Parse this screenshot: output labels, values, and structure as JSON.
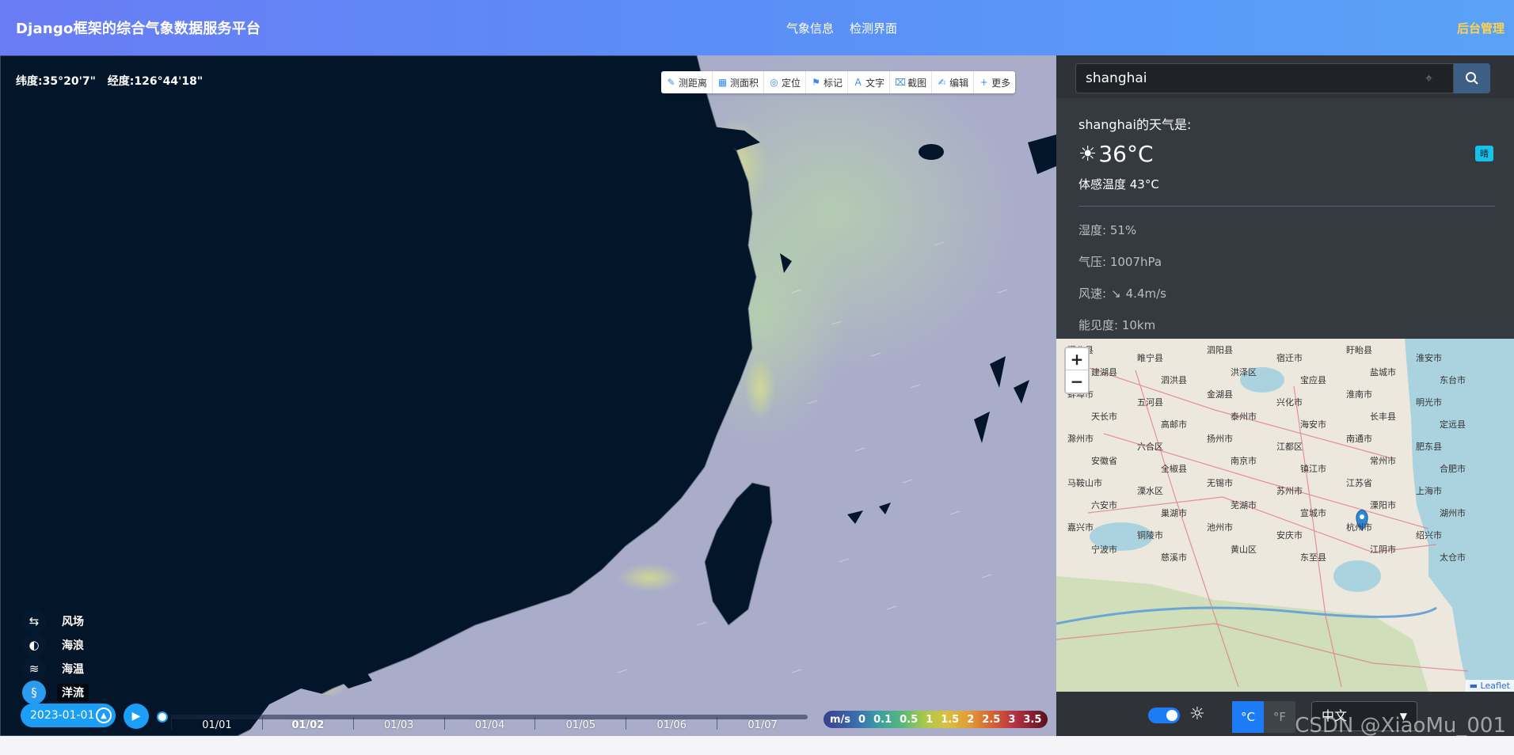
{
  "header": {
    "brand": "Django框架的综合气象数据服务平台",
    "nav": [
      "气象信息",
      "检测界面"
    ],
    "admin": "后台管理"
  },
  "map": {
    "latitude": "纬度:35°20'7\"",
    "longitude": "经度:126°44'18\"",
    "tools": [
      {
        "label": "测距离",
        "icon": "ruler-icon",
        "glyph": "✎"
      },
      {
        "label": "测面积",
        "icon": "area-icon",
        "glyph": "▦"
      },
      {
        "label": "定位",
        "icon": "location-icon",
        "glyph": "◎"
      },
      {
        "label": "标记",
        "icon": "flag-icon",
        "glyph": "⚑"
      },
      {
        "label": "文字",
        "icon": "text-icon",
        "glyph": "A"
      },
      {
        "label": "截图",
        "icon": "crop-icon",
        "glyph": "⌧"
      },
      {
        "label": "编辑",
        "icon": "edit-icon",
        "glyph": "✍"
      },
      {
        "label": "更多",
        "icon": "plus-icon",
        "glyph": "+"
      }
    ],
    "layers": [
      {
        "label": "风场",
        "icon": "wind-icon",
        "glyph": "⇆",
        "active": false
      },
      {
        "label": "海浪",
        "icon": "wave-icon",
        "glyph": "◐",
        "active": false
      },
      {
        "label": "海温",
        "icon": "water-temp-icon",
        "glyph": "≋",
        "active": false
      },
      {
        "label": "洋流",
        "icon": "current-icon",
        "glyph": "§",
        "active": true
      }
    ],
    "timeline": {
      "date": "2023-01-01",
      "days": [
        "01/01",
        "01/02",
        "01/03",
        "01/04",
        "01/05",
        "01/06",
        "01/07"
      ],
      "current_index": 1
    },
    "legend": {
      "unit": "m/s",
      "values": [
        "0",
        "0.1",
        "0.5",
        "1",
        "1.5",
        "2",
        "2.5",
        "3",
        "3.5"
      ]
    }
  },
  "panel": {
    "search_value": "shanghai",
    "weather_title": "shanghai的天气是:",
    "temperature": "36°C",
    "condition_badge": "晴",
    "feels_like": "体感温度 43°C",
    "humidity": "湿度: 51%",
    "pressure": "气压: 1007hPa",
    "wind_label": "风速:",
    "wind_arrow": "↘",
    "wind_value": "4.4m/s",
    "visibility": "能见度: 10km",
    "minimap": {
      "zoom_in": "+",
      "zoom_out": "−",
      "attribution": "Leaflet",
      "places": [
        "灌北县",
        "睢宁县",
        "泗阳县",
        "宿迁市",
        "盱眙县",
        "淮安市",
        "建湖县",
        "泗洪县",
        "洪泽区",
        "宝应县",
        "盐城市",
        "东台市",
        "蚌埠市",
        "五河县",
        "金湖县",
        "兴化市",
        "淮南市",
        "明光市",
        "天长市",
        "高邮市",
        "泰州市",
        "海安市",
        "长丰县",
        "定远县",
        "滁州市",
        "六合区",
        "扬州市",
        "江都区",
        "南通市",
        "肥东县",
        "安徽省",
        "全椒县",
        "南京市",
        "镇江市",
        "常州市",
        "合肥市",
        "马鞍山市",
        "溧水区",
        "无锡市",
        "苏州市",
        "江苏省",
        "上海市",
        "六安市",
        "巢湖市",
        "芜湖市",
        "宣城市",
        "溧阳市",
        "湖州市",
        "嘉兴市",
        "铜陵市",
        "池州市",
        "安庆市",
        "杭州市",
        "绍兴市",
        "宁波市",
        "慈溪市",
        "黄山区",
        "东至县",
        "江阴市",
        "太仓市"
      ]
    },
    "units": [
      "°C",
      "°F"
    ],
    "language": "中文"
  },
  "watermark": "CSDN @XiaoMu_001",
  "colors": {
    "header_start": "#6a7cf4",
    "header_end": "#5aa2f8",
    "land": "#031528",
    "sea": "#a8acc8",
    "accent": "#1b9ef6",
    "admin": "#ffd24a"
  }
}
